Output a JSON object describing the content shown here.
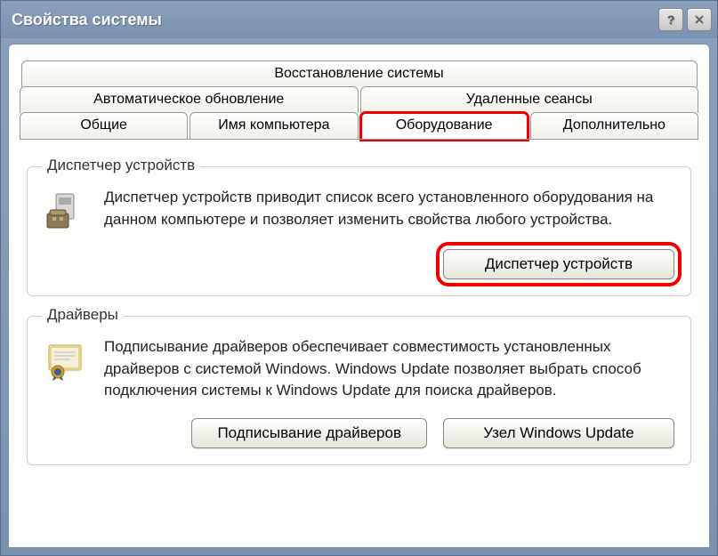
{
  "window": {
    "title": "Свойства системы"
  },
  "tabs": {
    "row1": [
      "Восстановление системы"
    ],
    "row2": [
      "Автоматическое обновление",
      "Удаленные сеансы"
    ],
    "row3": [
      "Общие",
      "Имя компьютера",
      "Оборудование",
      "Дополнительно"
    ],
    "active": "Оборудование"
  },
  "groups": {
    "device_manager": {
      "title": "Диспетчер устройств",
      "text": "Диспетчер устройств приводит список всего установленного оборудования на данном компьютере и позволяет изменить свойства любого устройства.",
      "button": "Диспетчер устройств"
    },
    "drivers": {
      "title": "Драйверы",
      "text": "Подписывание драйверов обеспечивает совместимость установленных драйверов с системой Windows.  Windows Update позволяет выбрать способ подключения системы к Windows Update для поиска драйверов.",
      "button_signing": "Подписывание драйверов",
      "button_wu": "Узел Windows Update"
    }
  },
  "highlights": {
    "tab": "Оборудование",
    "button": "Диспетчер устройств"
  }
}
